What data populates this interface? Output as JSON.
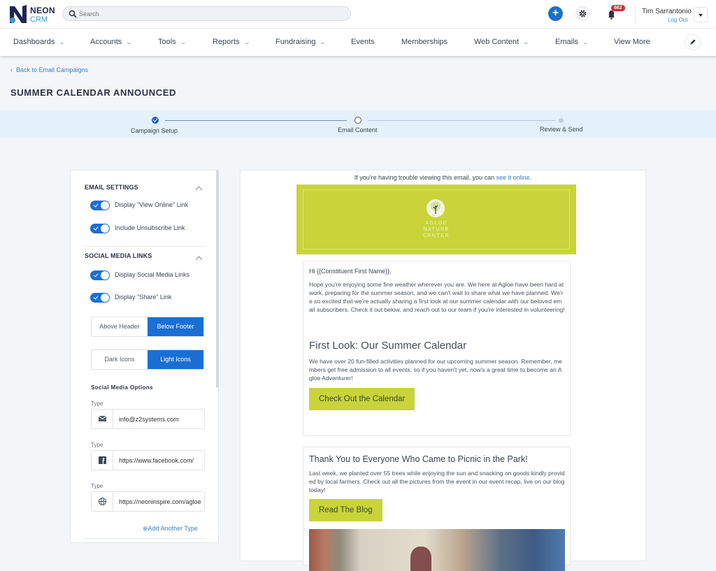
{
  "app": {
    "brand_top": "NEON",
    "brand_bottom": "CRM",
    "search_placeholder": "Search",
    "notifications_count": "662",
    "user_name": "Tim Sarrantonio",
    "logout_label": "Log Out",
    "accent": "#1a6fd4"
  },
  "nav": {
    "items": [
      {
        "label": "Dashboards",
        "has_dropdown": true
      },
      {
        "label": "Accounts",
        "has_dropdown": true
      },
      {
        "label": "Tools",
        "has_dropdown": true
      },
      {
        "label": "Reports",
        "has_dropdown": true
      },
      {
        "label": "Fundraising",
        "has_dropdown": true
      },
      {
        "label": "Events",
        "has_dropdown": false
      },
      {
        "label": "Memberships",
        "has_dropdown": false
      },
      {
        "label": "Web Content",
        "has_dropdown": true
      },
      {
        "label": "Emails",
        "has_dropdown": true
      },
      {
        "label": "View More",
        "has_dropdown": false
      }
    ],
    "chevron": "⌄"
  },
  "page": {
    "back_label": "Back to Email Campaigns",
    "title": "SUMMER CALENDAR ANNOUNCED"
  },
  "stepper": {
    "steps": [
      {
        "label": "Campaign Setup",
        "state": "done"
      },
      {
        "label": "Email Content",
        "state": "current"
      },
      {
        "label": "Review & Send",
        "state": "future"
      }
    ]
  },
  "settings": {
    "email_settings_title": "EMAIL SETTINGS",
    "toggles_email": [
      {
        "label": "Display \"View Online\" Link",
        "on": true
      },
      {
        "label": "Include Unsubscribe Link",
        "on": true
      }
    ],
    "social_title": "SOCIAL MEDIA LINKS",
    "toggles_social": [
      {
        "label": "Display Social Media Links",
        "on": true
      },
      {
        "label": "Display \"Share\" Link",
        "on": true
      }
    ],
    "position_options": [
      "Above Header",
      "Below Footer"
    ],
    "position_selected": "Below Footer",
    "icon_options": [
      "Dark Icons",
      "Light Icons"
    ],
    "icon_selected": "Light Icons",
    "options_title": "Social Media Options",
    "type_label": "Type",
    "social_items": [
      {
        "icon": "envelope-icon",
        "value": "info@z2systems.com"
      },
      {
        "icon": "facebook-icon",
        "value": "https://www.facebook.com/"
      },
      {
        "icon": "globe-icon",
        "value": "https://neoninspire.com/agloe"
      }
    ],
    "add_type_label": "Add Another Type"
  },
  "email": {
    "trouble_text": "If you're having trouble viewing this email, you can ",
    "trouble_link": "see it online",
    "trouble_end": ".",
    "org_name_lines": [
      "AGLOE",
      "NATURE",
      "CENTER"
    ],
    "brand_color": "#c8d43a",
    "greeting": "Hi {{Constituent First Name}},",
    "intro": "Hope you're enjoying some fine weather wherever you are. We here at Agloe have been hard at work, preparing for the summer season, and we can't wait to share what we have planned. We're so excited that we're actually sharing a first look at our summer calendar with our beloved email subscribers. Check it out below, and reach out to our team if you're interested in volunteering!",
    "section1_title": "First Look: Our Summer Calendar",
    "section1_body": "We have over 20 fun-filled activities planned for our upcoming summer season. Remember, members get free admission to all events, so if you haven't yet, now's a great time to become an Agloe Adventurer!",
    "section1_cta": "Check Out the Calendar",
    "section2_title": "Thank You to Everyone Who Came to Picnic in the Park!",
    "section2_body": "Last week, we planted over 55 trees while enjoying the sun and snacking on goods kindly provided by local farmers. Check out all the pictures from the event in our event recap, live on our blog today!",
    "section2_cta": "Read The Blog"
  }
}
